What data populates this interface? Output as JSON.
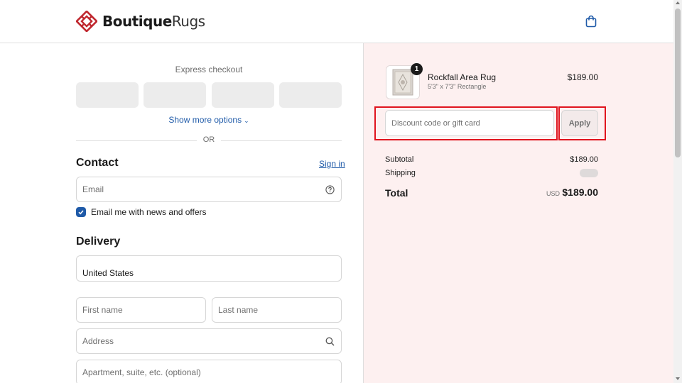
{
  "brand": {
    "name_bold": "Boutique",
    "name_light": "Rugs",
    "logo_color": "#c0282f"
  },
  "header": {
    "cart_icon": "shopping-bag-icon"
  },
  "express": {
    "title": "Express checkout",
    "show_more": "Show more options",
    "or": "OR"
  },
  "contact": {
    "title": "Contact",
    "sign_in": "Sign in",
    "email_placeholder": "Email",
    "help_icon": "question-circle-icon",
    "newsletter_label": "Email me with news and offers",
    "newsletter_checked": true
  },
  "delivery": {
    "title": "Delivery",
    "country": "United States",
    "first_name_placeholder": "First name",
    "last_name_placeholder": "Last name",
    "address_placeholder": "Address",
    "apartment_placeholder": "Apartment, suite, etc. (optional)"
  },
  "order": {
    "product": {
      "name": "Rockfall Area Rug",
      "variant": "5'3\" x 7'3\" Rectangle",
      "price": "$189.00",
      "quantity": "1"
    },
    "discount_placeholder": "Discount code or gift card",
    "apply_label": "Apply",
    "subtotal_label": "Subtotal",
    "subtotal_value": "$189.00",
    "shipping_label": "Shipping",
    "total_label": "Total",
    "total_currency": "USD",
    "total_value": "$189.00"
  },
  "colors": {
    "accent": "#1f5aa8",
    "summary_bg": "#fdf0f0",
    "highlight": "#e0141e"
  }
}
